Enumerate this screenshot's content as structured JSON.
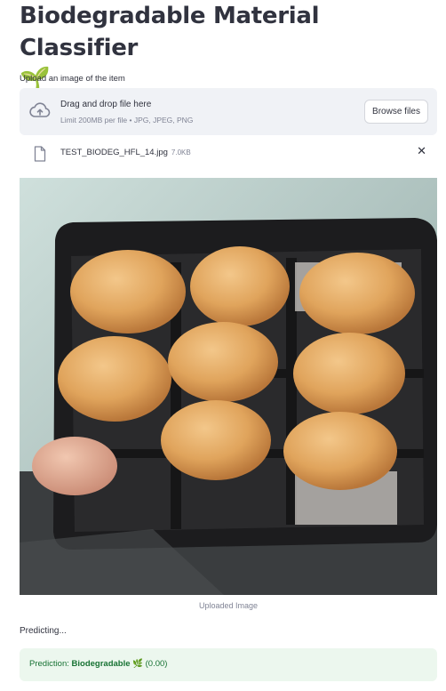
{
  "header": {
    "title": "Biodegradable Material Classifier",
    "title_emoji": "🌱"
  },
  "uploader": {
    "label": "Upload an image of the item",
    "dropzone_title": "Drag and drop file here",
    "dropzone_limit": "Limit 200MB per file • JPG, JPEG, PNG",
    "browse_label": "Browse files",
    "cloud_icon": "cloud-upload-icon"
  },
  "file": {
    "name": "TEST_BIODEG_HFL_14.jpg",
    "size": "7.0KB",
    "icon": "file-icon",
    "remove_glyph": "✕"
  },
  "image": {
    "caption": "Uploaded Image"
  },
  "status": {
    "predicting": "Predicting..."
  },
  "result": {
    "prefix": "Prediction: ",
    "label": "Biodegradable 🌿",
    "score": " (0.00)"
  },
  "colors": {
    "text": "#31333f",
    "muted": "#808495",
    "dropzone_bg": "#f0f2f6",
    "success_bg": "#ecf7ee",
    "success_text": "#177233"
  }
}
